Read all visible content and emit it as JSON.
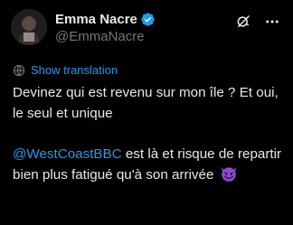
{
  "author": {
    "display_name": "Emma Nacre",
    "handle": "@EmmaNacre",
    "verified": true,
    "verified_icon": "verified-badge-icon"
  },
  "actions": {
    "grok_icon": "grok-icon",
    "more_icon": "more-icon"
  },
  "translate": {
    "label": "Show translation",
    "icon": "globe-icon"
  },
  "tweet": {
    "paragraph1": "Devinez qui est revenu sur mon île ? Et oui, le seul et unique",
    "mention": "@WestCoastBBC",
    "paragraph2_rest": " est là et risque de repartir bien plus fatigué qu'à son arrivée",
    "emoji": "smiling-face-with-horns-emoji"
  },
  "colors": {
    "background": "#000000",
    "text": "#e7e9ea",
    "secondary": "#71767b",
    "accent": "#1d9bf0",
    "emoji": "#8e4ad1"
  }
}
